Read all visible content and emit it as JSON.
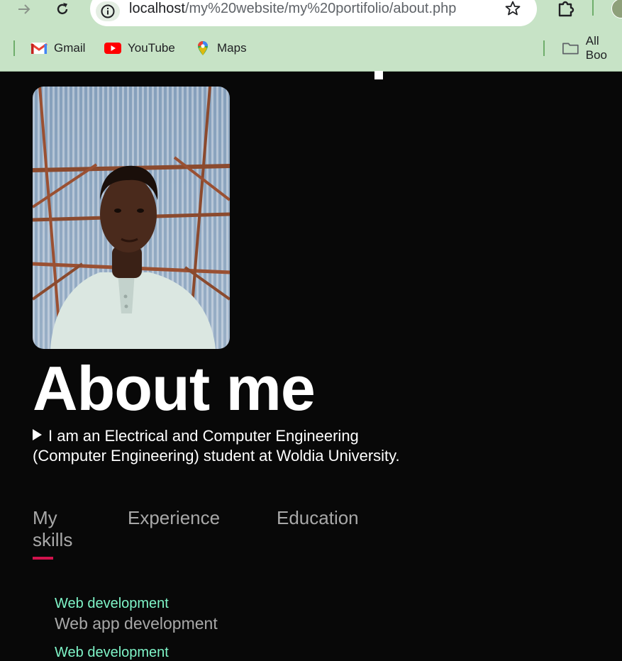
{
  "browser": {
    "url_host": "localhost",
    "url_path": "/my%20website/my%20portifolio/about.php",
    "bookmarks": [
      "Gmail",
      "YouTube",
      "Maps"
    ],
    "all_bookmarks": "All Boo"
  },
  "page": {
    "title": "About me",
    "intro": "I am an Electrical and Computer Engineering (Computer Engineering) student at Woldia University.",
    "tabs": [
      {
        "label": "My skills",
        "active": true
      },
      {
        "label": "Experience",
        "active": false
      },
      {
        "label": "Education",
        "active": false
      }
    ],
    "skills": [
      {
        "name": "Web development",
        "desc": "Web app development"
      },
      {
        "name": "Web development",
        "desc": ""
      }
    ],
    "colors": {
      "background": "#080808",
      "accent_underline": "#d1134d",
      "skill_name": "#7ff5c8",
      "tab_text": "#a8a8a8"
    }
  }
}
